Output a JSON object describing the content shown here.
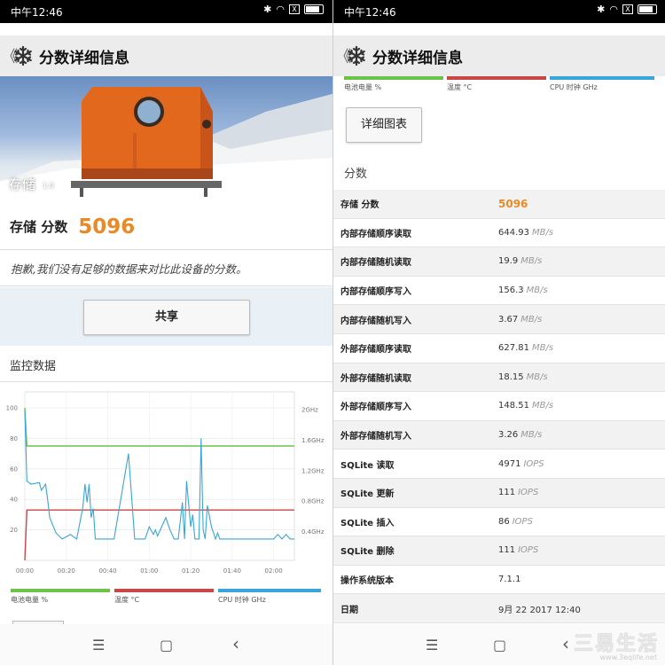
{
  "status": {
    "time": "中午12:46",
    "x_label": "X"
  },
  "appbar": {
    "back": "《",
    "title": "分数详细信息"
  },
  "hero": {
    "label": "存储",
    "version": "1.0"
  },
  "score": {
    "label": "存储 分数",
    "value": "5096"
  },
  "notice": "抱歉,我们没有足够的数据来对比此设备的分数。",
  "share_label": "共享",
  "monitor_title": "监控数据",
  "legend": [
    {
      "label": "电池电量 %",
      "color": "#6cc24a"
    },
    {
      "label": "温度 °C",
      "color": "#c94747"
    },
    {
      "label": "CPU 时钟 GHz",
      "color": "#3aa5d8"
    }
  ],
  "chart_data": {
    "type": "line",
    "x_ticks": [
      "00:00",
      "00:20",
      "00:40",
      "01:00",
      "01:20",
      "01:40",
      "02:00"
    ],
    "y_left_ticks": [
      20,
      40,
      60,
      80,
      100
    ],
    "y_right_ticks": [
      "0.4GHz",
      "0.8GHz",
      "1.2GHz",
      "1.6GHz",
      "2GHz"
    ],
    "ylim": [
      0,
      100
    ],
    "xlim": [
      0,
      130
    ],
    "series": [
      {
        "name": "电池电量 %",
        "color": "#6cc24a",
        "x": [
          0,
          1,
          130
        ],
        "y": [
          100,
          75,
          75
        ]
      },
      {
        "name": "温度 °C",
        "color": "#c94747",
        "x": [
          0,
          1,
          130
        ],
        "y": [
          0,
          33,
          33
        ]
      },
      {
        "name": "CPU 时钟 GHz",
        "color": "#3aa5d8",
        "x": [
          0,
          1,
          2,
          3,
          7,
          8,
          10,
          11,
          12,
          15,
          18,
          22,
          25,
          28,
          29,
          30,
          31,
          32,
          33,
          34,
          35,
          36,
          38,
          40,
          43,
          50,
          53,
          54,
          55,
          56,
          58,
          60,
          62,
          63,
          64,
          68,
          70,
          72,
          74,
          76,
          77,
          78,
          80,
          81,
          82,
          84,
          85,
          86,
          87,
          88,
          90,
          92,
          93,
          94,
          96,
          98,
          100,
          102,
          110,
          120,
          122,
          124,
          126,
          128,
          130
        ],
        "y": [
          98,
          52,
          51,
          50,
          51,
          46,
          50,
          40,
          28,
          18,
          14,
          17,
          14,
          35,
          50,
          38,
          50,
          28,
          34,
          14,
          14,
          14,
          14,
          14,
          14,
          70,
          14,
          14,
          14,
          14,
          14,
          22,
          17,
          20,
          16,
          28,
          20,
          14,
          14,
          38,
          14,
          52,
          22,
          30,
          14,
          14,
          80,
          20,
          14,
          36,
          22,
          14,
          18,
          14,
          14,
          14,
          14,
          14,
          14,
          14,
          17,
          14,
          17,
          14,
          14
        ]
      }
    ]
  },
  "detail_chart_label": "详细图表",
  "scores_section": "分数",
  "rows": [
    {
      "key": "存储 分数",
      "value": "5096",
      "unit": ""
    },
    {
      "key": "内部存储顺序读取",
      "value": "644.93",
      "unit": "MB/s"
    },
    {
      "key": "内部存储随机读取",
      "value": "19.9",
      "unit": "MB/s"
    },
    {
      "key": "内部存储顺序写入",
      "value": "156.3",
      "unit": "MB/s"
    },
    {
      "key": "内部存储随机写入",
      "value": "3.67",
      "unit": "MB/s"
    },
    {
      "key": "外部存储顺序读取",
      "value": "627.81",
      "unit": "MB/s"
    },
    {
      "key": "外部存储随机读取",
      "value": "18.15",
      "unit": "MB/s"
    },
    {
      "key": "外部存储顺序写入",
      "value": "148.51",
      "unit": "MB/s"
    },
    {
      "key": "外部存储随机写入",
      "value": "3.26",
      "unit": "MB/s"
    },
    {
      "key": "SQLite 读取",
      "value": "4971",
      "unit": "IOPS"
    },
    {
      "key": "SQLite 更新",
      "value": "111",
      "unit": "IOPS"
    },
    {
      "key": "SQLite 插入",
      "value": "86",
      "unit": "IOPS"
    },
    {
      "key": "SQLite 删除",
      "value": "111",
      "unit": "IOPS"
    },
    {
      "key": "操作系统版本",
      "value": "7.1.1",
      "unit": ""
    },
    {
      "key": "日期",
      "value": "9月 22 2017 12:40",
      "unit": ""
    }
  ],
  "nav": {
    "menu": "☰",
    "home": "▢",
    "back": "‹"
  },
  "watermark": {
    "big": "三易生活",
    "small": "www.3eqlife.net"
  }
}
